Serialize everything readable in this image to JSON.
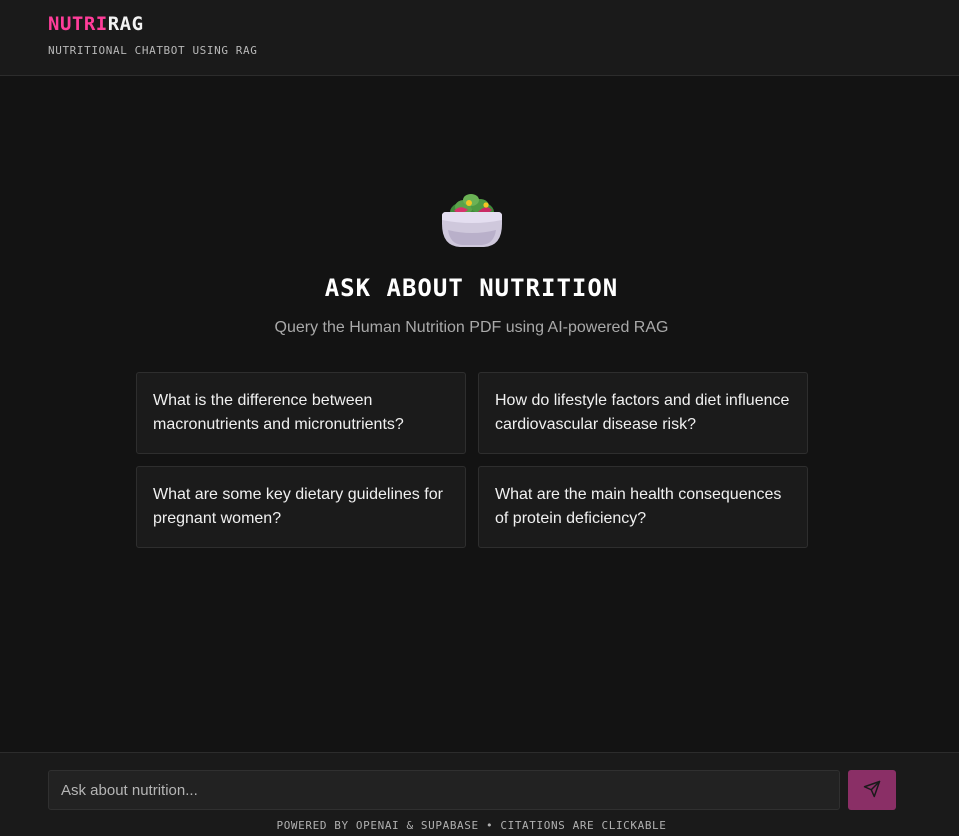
{
  "header": {
    "brand_accent": "NUTRI",
    "brand_rest": "RAG",
    "subtitle": "NUTRITIONAL CHATBOT USING RAG"
  },
  "hero": {
    "icon": "salad-bowl-icon",
    "title": "ASK ABOUT NUTRITION",
    "subtitle": "Query the Human Nutrition PDF using AI-powered RAG"
  },
  "suggestions": [
    "What is the difference between macronutrients and micronutrients?",
    "How do lifestyle factors and diet influence cardiovascular disease risk?",
    "What are some key dietary guidelines for pregnant women?",
    "What are the main health consequences of protein deficiency?"
  ],
  "composer": {
    "placeholder": "Ask about nutrition...",
    "send_icon": "send-icon",
    "footnote": "POWERED BY OPENAI & SUPABASE • CITATIONS ARE CLICKABLE"
  },
  "colors": {
    "accent": "#ff3d9a",
    "send_button": "#8a2f66",
    "background": "#131313"
  }
}
